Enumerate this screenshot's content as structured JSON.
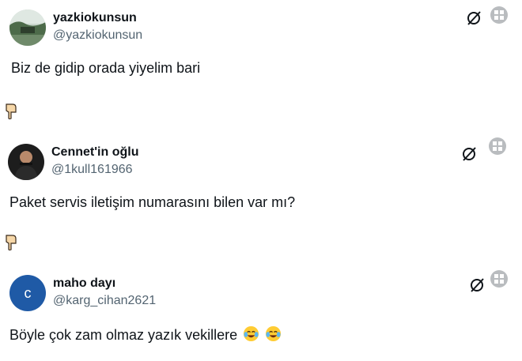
{
  "tweets": [
    {
      "display_name": "yazkiokunsun",
      "handle": "@yazkiokunsun",
      "text": "Biz de gidip orada yiyelim bari",
      "avatar_type": "photo-landscape"
    },
    {
      "display_name": "Cennet'in oğlu",
      "handle": "@1kull161966",
      "text": "Paket servis iletişim numarasını bilen var mı?",
      "avatar_type": "photo-person"
    },
    {
      "display_name": "maho dayı",
      "handle": "@karg_cihan2621",
      "text": "Böyle çok zam olmaz yazık vekillere",
      "avatar_letter": "c",
      "avatar_color": "#1f5aa6",
      "emojis": [
        "face-with-tears-of-joy",
        "face-with-tears-of-joy"
      ]
    }
  ],
  "icons": {
    "grok": "slashed-circle-icon",
    "more": "image-grid-icon",
    "pointer": "hand-pointing-down-icon"
  },
  "pointer_glyph": "👇"
}
